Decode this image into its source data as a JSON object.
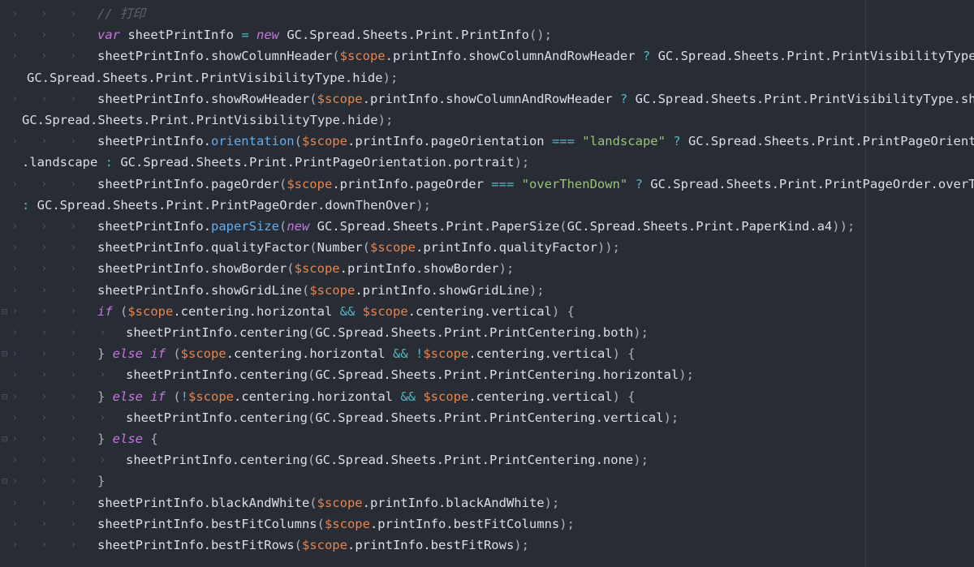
{
  "editor": {
    "lines": [
      {
        "fold": false,
        "guides": 3,
        "tokens": [
          [
            "cm",
            "// 打印"
          ]
        ]
      },
      {
        "fold": false,
        "guides": 3,
        "tokens": [
          [
            "kw",
            "var"
          ],
          [
            "id",
            " sheetPrintInfo "
          ],
          [
            "op",
            "="
          ],
          [
            "kw",
            " new"
          ],
          [
            "id",
            " GC.Spread.Sheets.Print.PrintInfo"
          ],
          [
            "pn",
            "();"
          ]
        ]
      },
      {
        "fold": false,
        "guides": 3,
        "tokens": [
          [
            "id",
            "sheetPrintInfo.showColumnHeader"
          ],
          [
            "pn",
            "("
          ],
          [
            "sc",
            "$scope"
          ],
          [
            "id",
            ".printInfo.showColumnAndRowHeader "
          ],
          [
            "op",
            "?"
          ],
          [
            "id",
            " GC.Spread.Sheets.Print.PrintVisibilityType.show "
          ],
          [
            "op",
            ":"
          ]
        ]
      },
      {
        "fold": false,
        "guides": 0,
        "cont": true,
        "tokens": [
          [
            "id",
            "GC.Spread.Sheets.Print.PrintVisibilityType.hide"
          ],
          [
            "pn",
            ");"
          ]
        ]
      },
      {
        "fold": false,
        "guides": 3,
        "tokens": [
          [
            "id",
            "sheetPrintInfo.showRowHeader"
          ],
          [
            "pn",
            "("
          ],
          [
            "sc",
            "$scope"
          ],
          [
            "id",
            ".printInfo.showColumnAndRowHeader "
          ],
          [
            "op",
            "?"
          ],
          [
            "id",
            " GC.Spread.Sheets.Print.PrintVisibilityType.show "
          ],
          [
            "op",
            ":"
          ]
        ]
      },
      {
        "fold": false,
        "guides": 0,
        "cont": true,
        "tokens": [
          [
            "id",
            "GC.Spread.Sheets.Print.PrintVisibilityType.hide"
          ],
          [
            "pn",
            ");"
          ]
        ]
      },
      {
        "fold": false,
        "guides": 3,
        "tokens": [
          [
            "id",
            "sheetPrintInfo."
          ],
          [
            "fnb",
            "orientation"
          ],
          [
            "pn",
            "("
          ],
          [
            "sc",
            "$scope"
          ],
          [
            "id",
            ".printInfo.pageOrientation "
          ],
          [
            "op",
            "==="
          ],
          [
            "str",
            " \"landscape\""
          ],
          [
            "op",
            " ?"
          ],
          [
            "id",
            " GC.Spread.Sheets.Print.PrintPageOrientation"
          ]
        ]
      },
      {
        "fold": false,
        "guides": 0,
        "cont": true,
        "tokens": [
          [
            "id",
            ".landscape "
          ],
          [
            "op",
            ":"
          ],
          [
            "id",
            " GC.Spread.Sheets.Print.PrintPageOrientation.portrait"
          ],
          [
            "pn",
            ");"
          ]
        ]
      },
      {
        "fold": false,
        "guides": 3,
        "tokens": [
          [
            "id",
            "sheetPrintInfo.pageOrder"
          ],
          [
            "pn",
            "("
          ],
          [
            "sc",
            "$scope"
          ],
          [
            "id",
            ".printInfo.pageOrder "
          ],
          [
            "op",
            "==="
          ],
          [
            "str",
            " \"overThenDown\""
          ],
          [
            "op",
            " ?"
          ],
          [
            "id",
            " GC.Spread.Sheets.Print.PrintPageOrder.overThenDown"
          ]
        ]
      },
      {
        "fold": false,
        "guides": 0,
        "cont": true,
        "tokens": [
          [
            "op",
            ":"
          ],
          [
            "id",
            " GC.Spread.Sheets.Print.PrintPageOrder.downThenOver"
          ],
          [
            "pn",
            ");"
          ]
        ]
      },
      {
        "fold": false,
        "guides": 3,
        "tokens": [
          [
            "id",
            "sheetPrintInfo."
          ],
          [
            "fnb",
            "paperSize"
          ],
          [
            "pn",
            "("
          ],
          [
            "kw",
            "new"
          ],
          [
            "id",
            " GC.Spread.Sheets.Print.PaperSize"
          ],
          [
            "pn",
            "("
          ],
          [
            "id",
            "GC.Spread.Sheets.Print.PaperKind.a4"
          ],
          [
            "pn",
            "));"
          ]
        ]
      },
      {
        "fold": false,
        "guides": 3,
        "tokens": [
          [
            "id",
            "sheetPrintInfo.qualityFactor"
          ],
          [
            "pn",
            "("
          ],
          [
            "id",
            "Number"
          ],
          [
            "pn",
            "("
          ],
          [
            "sc",
            "$scope"
          ],
          [
            "id",
            ".printInfo.qualityFactor"
          ],
          [
            "pn",
            "));"
          ]
        ]
      },
      {
        "fold": false,
        "guides": 3,
        "tokens": [
          [
            "id",
            "sheetPrintInfo.showBorder"
          ],
          [
            "pn",
            "("
          ],
          [
            "sc",
            "$scope"
          ],
          [
            "id",
            ".printInfo.showBorder"
          ],
          [
            "pn",
            ");"
          ]
        ]
      },
      {
        "fold": false,
        "guides": 3,
        "tokens": [
          [
            "id",
            "sheetPrintInfo.showGridLine"
          ],
          [
            "pn",
            "("
          ],
          [
            "sc",
            "$scope"
          ],
          [
            "id",
            ".printInfo.showGridLine"
          ],
          [
            "pn",
            ");"
          ]
        ]
      },
      {
        "fold": true,
        "guides": 3,
        "tokens": [
          [
            "kw",
            "if"
          ],
          [
            "pn",
            " ("
          ],
          [
            "sc",
            "$scope"
          ],
          [
            "id",
            ".centering.horizontal "
          ],
          [
            "op",
            "&&"
          ],
          [
            "sc",
            " $scope"
          ],
          [
            "id",
            ".centering.vertical"
          ],
          [
            "pn",
            ") {"
          ]
        ]
      },
      {
        "fold": false,
        "guides": 4,
        "tokens": [
          [
            "id",
            "sheetPrintInfo.centering"
          ],
          [
            "pn",
            "("
          ],
          [
            "id",
            "GC.Spread.Sheets.Print.PrintCentering.both"
          ],
          [
            "pn",
            ");"
          ]
        ]
      },
      {
        "fold": true,
        "guides": 3,
        "tokens": [
          [
            "pn",
            "} "
          ],
          [
            "kw",
            "else if"
          ],
          [
            "pn",
            " ("
          ],
          [
            "sc",
            "$scope"
          ],
          [
            "id",
            ".centering.horizontal "
          ],
          [
            "op",
            "&&"
          ],
          [
            "op",
            " !"
          ],
          [
            "sc",
            "$scope"
          ],
          [
            "id",
            ".centering.vertical"
          ],
          [
            "pn",
            ") {"
          ]
        ]
      },
      {
        "fold": false,
        "guides": 4,
        "tokens": [
          [
            "id",
            "sheetPrintInfo.centering"
          ],
          [
            "pn",
            "("
          ],
          [
            "id",
            "GC.Spread.Sheets.Print.PrintCentering.horizontal"
          ],
          [
            "pn",
            ");"
          ]
        ]
      },
      {
        "fold": true,
        "guides": 3,
        "tokens": [
          [
            "pn",
            "} "
          ],
          [
            "kw",
            "else if"
          ],
          [
            "pn",
            " ("
          ],
          [
            "op",
            "!"
          ],
          [
            "sc",
            "$scope"
          ],
          [
            "id",
            ".centering.horizontal "
          ],
          [
            "op",
            "&&"
          ],
          [
            "sc",
            " $scope"
          ],
          [
            "id",
            ".centering.vertical"
          ],
          [
            "pn",
            ") {"
          ]
        ]
      },
      {
        "fold": false,
        "guides": 4,
        "tokens": [
          [
            "id",
            "sheetPrintInfo.centering"
          ],
          [
            "pn",
            "("
          ],
          [
            "id",
            "GC.Spread.Sheets.Print.PrintCentering.vertical"
          ],
          [
            "pn",
            ");"
          ]
        ]
      },
      {
        "fold": true,
        "guides": 3,
        "tokens": [
          [
            "pn",
            "} "
          ],
          [
            "kw",
            "else"
          ],
          [
            "pn",
            " {"
          ]
        ]
      },
      {
        "fold": false,
        "guides": 4,
        "tokens": [
          [
            "id",
            "sheetPrintInfo.centering"
          ],
          [
            "pn",
            "("
          ],
          [
            "id",
            "GC.Spread.Sheets.Print.PrintCentering.none"
          ],
          [
            "pn",
            ");"
          ]
        ]
      },
      {
        "fold": true,
        "guides": 3,
        "tokens": [
          [
            "pn",
            "}"
          ]
        ]
      },
      {
        "fold": false,
        "guides": 3,
        "tokens": [
          [
            "id",
            "sheetPrintInfo.blackAndWhite"
          ],
          [
            "pn",
            "("
          ],
          [
            "sc",
            "$scope"
          ],
          [
            "id",
            ".printInfo.blackAndWhite"
          ],
          [
            "pn",
            ");"
          ]
        ]
      },
      {
        "fold": false,
        "guides": 3,
        "tokens": [
          [
            "id",
            "sheetPrintInfo.bestFitColumns"
          ],
          [
            "pn",
            "("
          ],
          [
            "sc",
            "$scope"
          ],
          [
            "id",
            ".printInfo.bestFitColumns"
          ],
          [
            "pn",
            ");"
          ]
        ]
      },
      {
        "fold": false,
        "guides": 3,
        "tokens": [
          [
            "id",
            "sheetPrintInfo.bestFitRows"
          ],
          [
            "pn",
            "("
          ],
          [
            "sc",
            "$scope"
          ],
          [
            "id",
            ".printInfo.bestFitRows"
          ],
          [
            "pn",
            ");"
          ]
        ]
      }
    ]
  },
  "icons": {
    "indent_guide": "chevron-right-icon",
    "fold_marker": "fold-marker-icon"
  },
  "colors": {
    "background": "#282c34",
    "keyword": "#c678dd",
    "scope_var": "#e5864f",
    "string": "#98c379",
    "operator": "#56b6c2",
    "comment": "#5c6370"
  }
}
